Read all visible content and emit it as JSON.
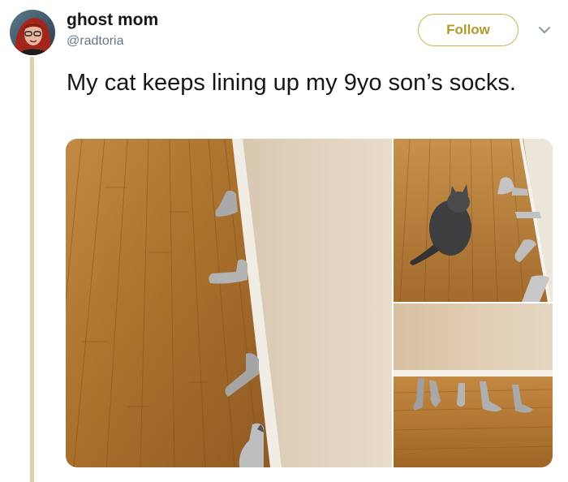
{
  "user": {
    "display_name": "ghost mom",
    "handle": "@radtoria"
  },
  "actions": {
    "follow_label": "Follow"
  },
  "tweet": {
    "text": "My cat keeps lining up my 9yo son’s socks."
  },
  "icons": {
    "menu": "chevron-down-icon"
  },
  "colors": {
    "thread_line": "#d8d4a6",
    "follow_accent": "#c8b552",
    "floor": "#b07a35",
    "wall": "#e2d2bc"
  }
}
